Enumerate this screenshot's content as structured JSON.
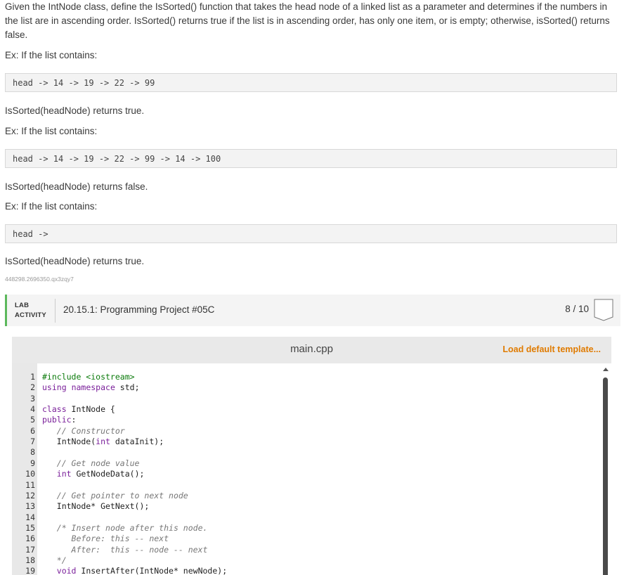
{
  "intro": "Given the IntNode class, define the IsSorted() function that takes the head node of a linked list as a parameter and determines if the numbers in the list are in ascending order. IsSorted() returns true if the list is in ascending order, has only one item, or is empty; otherwise, isSorted() returns false.",
  "examples": [
    {
      "lead": "Ex: If the list contains:",
      "code": "head -> 14 -> 19 -> 22 -> 99",
      "result": "IsSorted(headNode) returns true."
    },
    {
      "lead": "Ex: If the list contains:",
      "code": "head -> 14 -> 19 -> 22 -> 99 -> 14 -> 100",
      "result": "IsSorted(headNode) returns false."
    },
    {
      "lead": "Ex: If the list contains:",
      "code": "head ->",
      "result": "IsSorted(headNode) returns true."
    }
  ],
  "tracking_id": "448298.2696350.qx3zqy7",
  "lab": {
    "label_line1": "LAB",
    "label_line2": "ACTIVITY",
    "title": "20.15.1: Programming Project #05C",
    "score": "8 / 10"
  },
  "editor": {
    "filename": "main.cpp",
    "load_template": "Load default template...",
    "lines": [
      {
        "n": "1",
        "parts": [
          [
            "inc",
            "#include <iostream>"
          ]
        ]
      },
      {
        "n": "2",
        "parts": [
          [
            "kw",
            "using"
          ],
          [
            "",
            " "
          ],
          [
            "kw",
            "namespace"
          ],
          [
            "",
            " std;"
          ]
        ]
      },
      {
        "n": "3",
        "parts": []
      },
      {
        "n": "4",
        "parts": [
          [
            "kw",
            "class"
          ],
          [
            "",
            " IntNode {"
          ]
        ]
      },
      {
        "n": "5",
        "parts": [
          [
            "kw",
            "public"
          ],
          [
            "",
            ":"
          ]
        ]
      },
      {
        "n": "6",
        "parts": [
          [
            "",
            "   "
          ],
          [
            "cm",
            "// Constructor"
          ]
        ]
      },
      {
        "n": "7",
        "parts": [
          [
            "",
            "   IntNode("
          ],
          [
            "kw",
            "int"
          ],
          [
            "",
            " dataInit);"
          ]
        ]
      },
      {
        "n": "8",
        "parts": []
      },
      {
        "n": "9",
        "parts": [
          [
            "",
            "   "
          ],
          [
            "cm",
            "// Get node value"
          ]
        ]
      },
      {
        "n": "10",
        "parts": [
          [
            "",
            "   "
          ],
          [
            "kw",
            "int"
          ],
          [
            "",
            " GetNodeData();"
          ]
        ]
      },
      {
        "n": "11",
        "parts": []
      },
      {
        "n": "12",
        "parts": [
          [
            "",
            "   "
          ],
          [
            "cm",
            "// Get pointer to next node"
          ]
        ]
      },
      {
        "n": "13",
        "parts": [
          [
            "",
            "   IntNode* GetNext();"
          ]
        ]
      },
      {
        "n": "14",
        "parts": []
      },
      {
        "n": "15",
        "parts": [
          [
            "",
            "   "
          ],
          [
            "cm",
            "/* Insert node after this node."
          ]
        ]
      },
      {
        "n": "16",
        "parts": [
          [
            "cm",
            "      Before: this -- next"
          ]
        ]
      },
      {
        "n": "17",
        "parts": [
          [
            "cm",
            "      After:  this -- node -- next"
          ]
        ]
      },
      {
        "n": "18",
        "parts": [
          [
            "cm",
            "   */"
          ]
        ]
      },
      {
        "n": "19",
        "parts": [
          [
            "",
            "   "
          ],
          [
            "kw",
            "void"
          ],
          [
            "",
            " InsertAfter(IntNode* newNode);"
          ]
        ]
      }
    ]
  },
  "colors": {
    "accent_green": "#5cb85c",
    "link_orange": "#e07b00"
  }
}
